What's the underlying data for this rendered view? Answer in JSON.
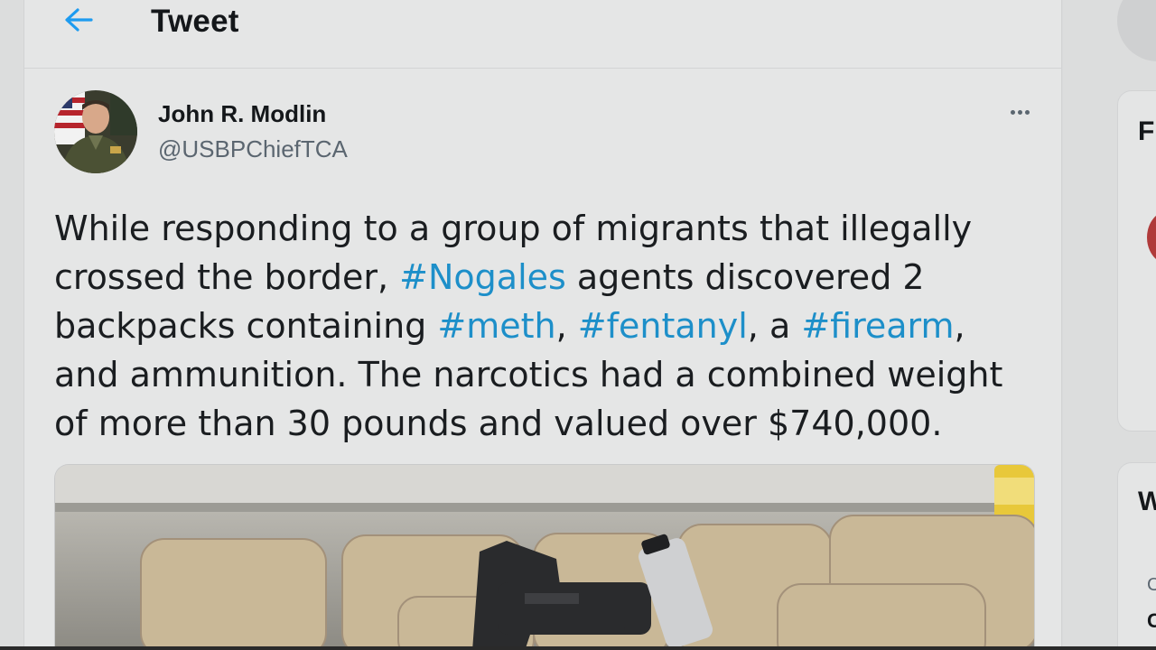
{
  "header": {
    "title": "Tweet",
    "back_icon": "arrow-left-icon"
  },
  "tweet": {
    "author": {
      "name": "John R. Modlin",
      "handle": "@USBPChiefTCA"
    },
    "more_icon": "more-horizontal-icon",
    "text": [
      {
        "t": "While responding to a group of migrants that illegally crossed the border, ",
        "tag": false
      },
      {
        "t": "#Nogales",
        "tag": true
      },
      {
        "t": " agents discovered 2 backpacks containing ",
        "tag": false
      },
      {
        "t": "#meth",
        "tag": true
      },
      {
        "t": ", ",
        "tag": false
      },
      {
        "t": "#fentanyl",
        "tag": true
      },
      {
        "t": ", a ",
        "tag": false
      },
      {
        "t": "#firearm",
        "tag": true
      },
      {
        "t": ", and ammunition. The narcotics had a combined weight of more than 30 pounds and valued over $740,000.",
        "tag": false
      }
    ]
  },
  "sidebar_partial": {
    "letters": [
      "F",
      "W",
      "C",
      "C"
    ]
  },
  "colors": {
    "accent": "#1d8fc9",
    "background": "#e5e6e6",
    "text_primary": "#14171a",
    "text_secondary": "#5b6670"
  }
}
